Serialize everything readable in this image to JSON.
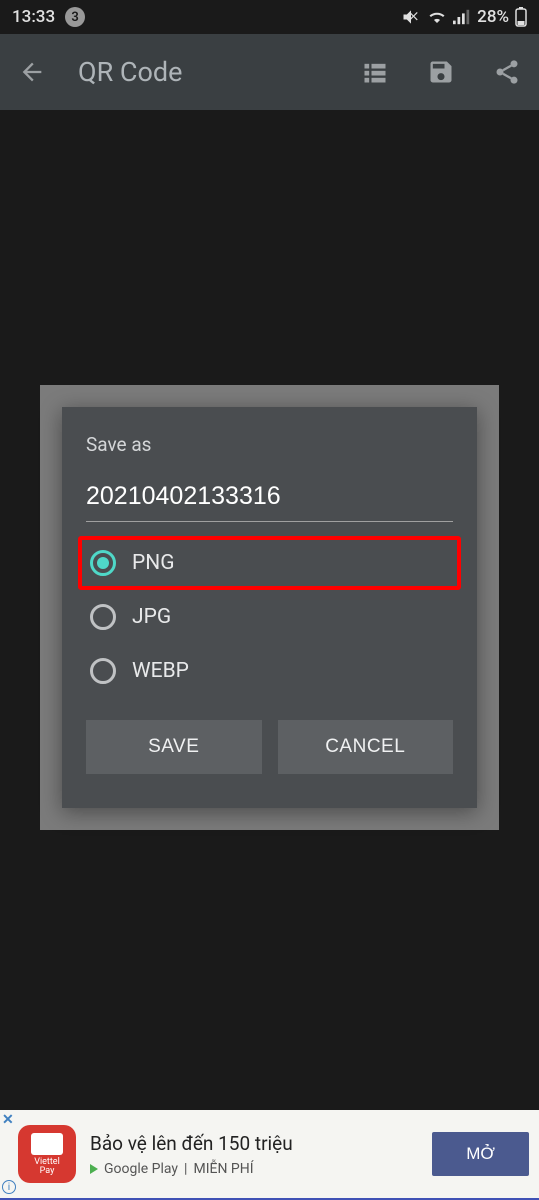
{
  "status": {
    "time": "13:33",
    "notif_count": "3",
    "battery": "28%"
  },
  "appbar": {
    "title": "QR Code"
  },
  "dialog": {
    "title": "Save as",
    "filename": "20210402133316",
    "options": [
      {
        "label": "PNG",
        "selected": true,
        "highlighted": true
      },
      {
        "label": "JPG",
        "selected": false,
        "highlighted": false
      },
      {
        "label": "WEBP",
        "selected": false,
        "highlighted": false
      }
    ],
    "save_label": "SAVE",
    "cancel_label": "CANCEL"
  },
  "ad": {
    "icon_text": "Viettel\nPay",
    "title": "Bảo vệ lên đến 150 triệu",
    "store": "Google Play",
    "separator": "|",
    "free": "MIỄN PHÍ",
    "cta": "MỞ"
  }
}
